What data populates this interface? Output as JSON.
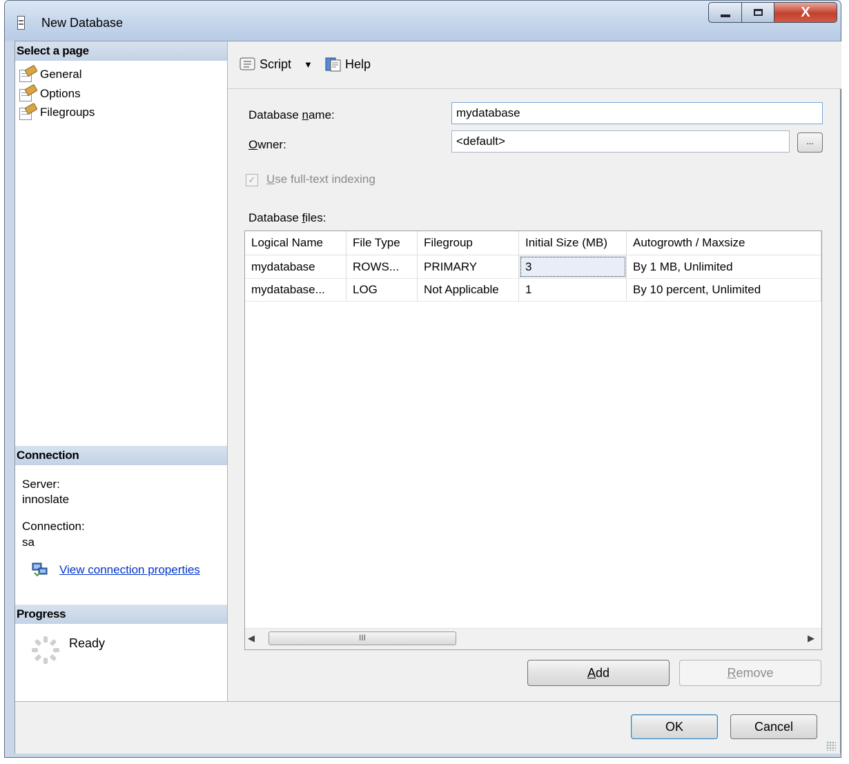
{
  "window": {
    "title": "New Database",
    "close_glyph": "X"
  },
  "left": {
    "select_page_heading": "Select a page",
    "pages": [
      {
        "label": "General",
        "icon": "page-properties-icon"
      },
      {
        "label": "Options",
        "icon": "page-properties-icon"
      },
      {
        "label": "Filegroups",
        "icon": "page-properties-icon"
      }
    ],
    "connection_heading": "Connection",
    "server_label": "Server:",
    "server_value": "innoslate",
    "connection_label": "Connection:",
    "connection_value": "sa",
    "view_connection_link": "View connection properties",
    "progress_heading": "Progress",
    "progress_status": "Ready"
  },
  "toolbar": {
    "script_label": "Script",
    "help_label": "Help"
  },
  "form": {
    "db_name_label_pre": "Database ",
    "db_name_label_u": "n",
    "db_name_label_post": "ame:",
    "db_name_value": "mydatabase",
    "owner_label_u": "O",
    "owner_label_post": "wner:",
    "owner_value": "<default>",
    "ellipsis_label": "...",
    "fulltext_label_u": "U",
    "fulltext_label_post": "se full-text indexing",
    "db_files_label_pre": "Database ",
    "db_files_label_u": "f",
    "db_files_label_post": "iles:"
  },
  "grid": {
    "columns": [
      "Logical Name",
      "File Type",
      "Filegroup",
      "Initial Size (MB)",
      "Autogrowth / Maxsize"
    ],
    "rows": [
      [
        "mydatabase",
        "ROWS...",
        "PRIMARY",
        "3",
        "By 1 MB, Unlimited"
      ],
      [
        "mydatabase...",
        "LOG",
        "Not Applicable",
        "1",
        "By 10 percent, Unlimited"
      ]
    ],
    "scroll_thumb_glyph": "III"
  },
  "buttons": {
    "add_u": "A",
    "add_post": "dd",
    "remove_u": "R",
    "remove_post": "emove",
    "ok": "OK",
    "cancel": "Cancel"
  }
}
